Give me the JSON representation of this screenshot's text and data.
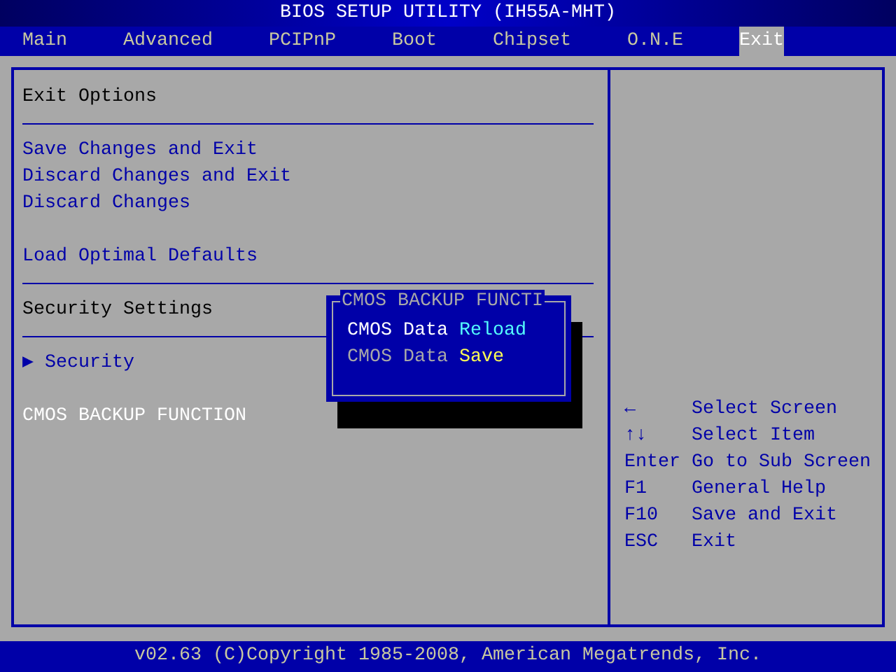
{
  "window": {
    "title": "BIOS SETUP UTILITY (IH55A-MHT)"
  },
  "tabs": [
    {
      "label": "Main",
      "selected": false
    },
    {
      "label": "Advanced",
      "selected": false
    },
    {
      "label": "PCIPnP",
      "selected": false
    },
    {
      "label": "Boot",
      "selected": false
    },
    {
      "label": "Chipset",
      "selected": false
    },
    {
      "label": "O.N.E",
      "selected": false
    },
    {
      "label": "Exit",
      "selected": true
    }
  ],
  "options_panel": {
    "rows": [
      {
        "kind": "heading",
        "text": "Exit Options"
      },
      {
        "kind": "divider"
      },
      {
        "kind": "item",
        "text": "Save Changes and Exit",
        "selected": false
      },
      {
        "kind": "item",
        "text": "Discard Changes and Exit",
        "selected": false
      },
      {
        "kind": "item",
        "text": "Discard Changes",
        "selected": false
      },
      {
        "kind": "spacer"
      },
      {
        "kind": "item",
        "text": "Load Optimal Defaults",
        "selected": false
      },
      {
        "kind": "divider"
      },
      {
        "kind": "heading",
        "text": "Security Settings"
      },
      {
        "kind": "divider"
      },
      {
        "kind": "submenu",
        "marker": "▶",
        "text": "Security",
        "selected": false
      },
      {
        "kind": "spacer"
      },
      {
        "kind": "item",
        "text": "CMOS BACKUP FUNCTION",
        "selected": true
      }
    ]
  },
  "popup": {
    "title": "CMOS BACKUP FUNCTI",
    "options": [
      {
        "prefix": "CMOS Data",
        "action": "Reload",
        "selected": true
      },
      {
        "prefix": "CMOS Data",
        "action": "Save",
        "selected": false
      }
    ]
  },
  "help": [
    {
      "key": "←",
      "action": "Select Screen"
    },
    {
      "key": "↑↓",
      "action": "Select Item"
    },
    {
      "key": "Enter",
      "action": "Go to Sub Screen"
    },
    {
      "key": "F1",
      "action": "General Help"
    },
    {
      "key": "F10",
      "action": "Save and Exit"
    },
    {
      "key": "ESC",
      "action": "Exit"
    }
  ],
  "footer": "v02.63 (C)Copyright 1985-2008, American Megatrends, Inc."
}
